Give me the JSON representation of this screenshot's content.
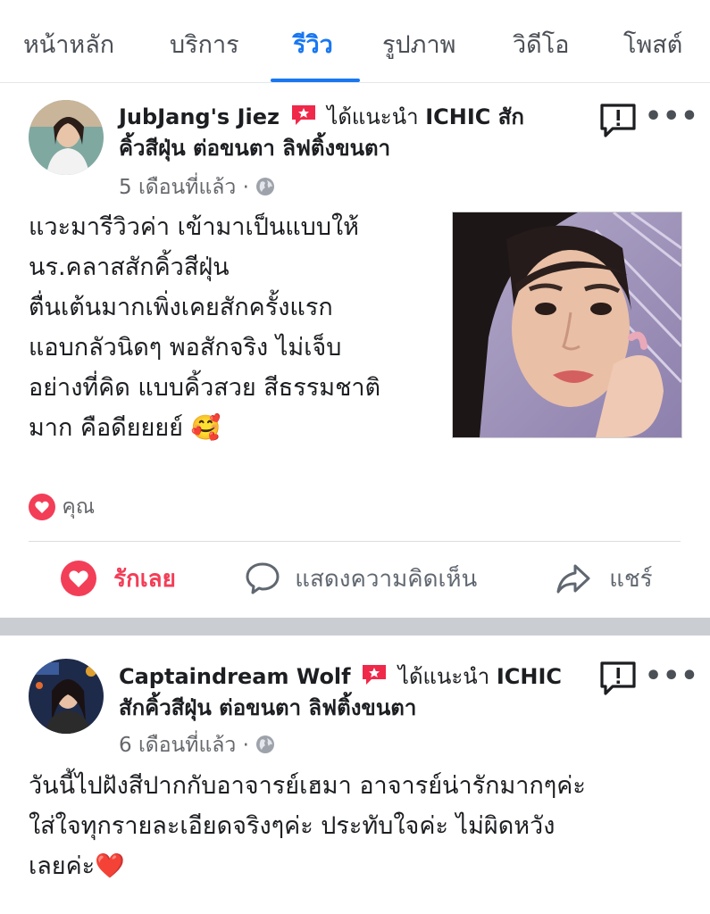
{
  "tabs": [
    {
      "label": "หน้าหลัก"
    },
    {
      "label": "บริการ"
    },
    {
      "label": "รีวิว"
    },
    {
      "label": "รูปภาพ"
    },
    {
      "label": "วิดีโอ"
    },
    {
      "label": "โพสต์"
    }
  ],
  "active_tab": "รีวิว",
  "colors": {
    "accent": "#1877f2",
    "love": "#f33e58",
    "recommend": "#f02849"
  },
  "posts": [
    {
      "author": "JubJang's Jiez",
      "recommend_text": "ได้แนะนำ",
      "page_name_part1": "ICHIC สัก",
      "page_name_part2": "คิ้วสีฝุ่น ต่อขนตา ลิฟติ้งขนตา",
      "time": "5 เดือนที่แล้ว",
      "body": [
        "แวะมารีวิวค่า เข้ามาเป็นแบบให้",
        "นร.คลาสสักคิ้วสีฝุ่น",
        "ตื่นเต้นมากเพิ่งเคยสักครั้งแรก",
        "แอบกลัวนิดๆ พอสักจริง ไม่เจ็บ",
        "อย่างที่คิด แบบคิ้วสวย สีธรรมชาติ",
        "มาก คือดียยยย์ 🥰"
      ],
      "reactions": "คุณ",
      "actions": {
        "love": "รักเลย",
        "comment": "แสดงความคิดเห็น",
        "share": "แชร์"
      }
    },
    {
      "author": "Captaindream Wolf",
      "recommend_text": "ได้แนะนำ",
      "page_name_part1": "ICHIC",
      "page_name_part2": "สักคิ้วสีฝุ่น ต่อขนตา ลิฟติ้งขนตา",
      "time": "6 เดือนที่แล้ว",
      "body": [
        "วันนี้ไปฝังสีปากกับอาจารย์เฮมา อาจารย์น่ารักมากๆค่ะ",
        "ใส่ใจทุกรายละเอียดจริงๆค่ะ ประทับใจค่ะ ไม่ผิดหวัง",
        "เลยค่ะ❤️"
      ]
    }
  ]
}
